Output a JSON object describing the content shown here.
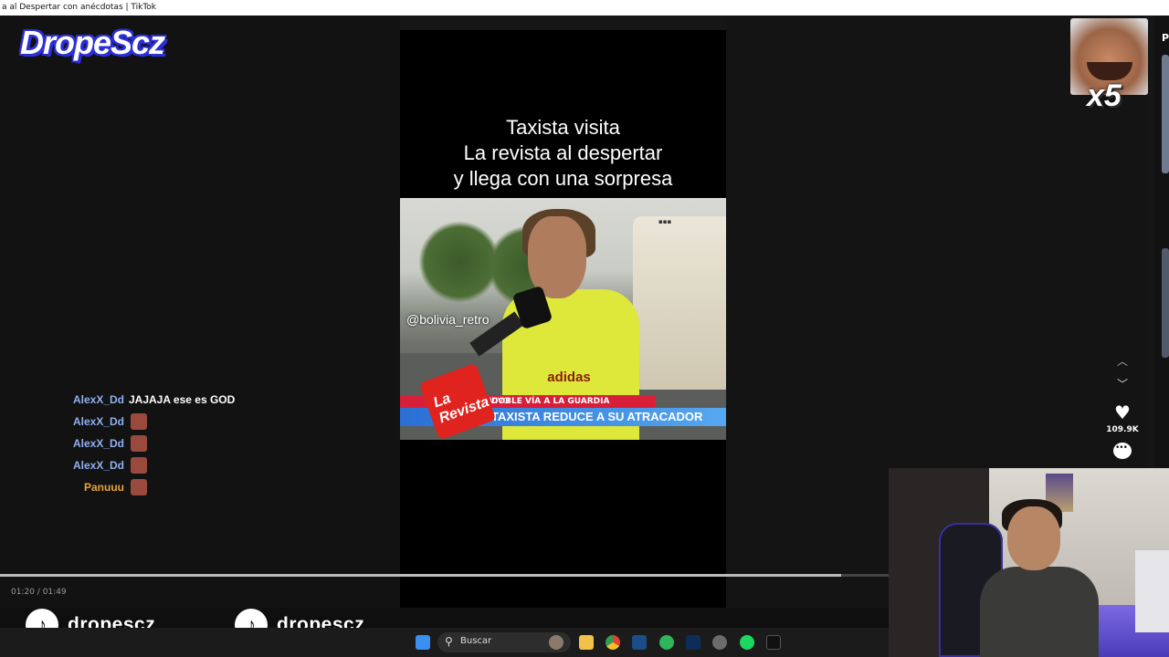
{
  "window": {
    "title": "a al Despertar con anécdotas | TikTok"
  },
  "stream_overlay": {
    "brand": "DropeScz",
    "emote_multiplier": "x5",
    "tiktok_handle_1": "dropescz",
    "tiktok_handle_2": "dropescz"
  },
  "video": {
    "caption_lines": [
      "Taxista visita",
      "La revista al despertar",
      "y llega con una sorpresa"
    ],
    "watermark": "@bolivia_retro",
    "brand_logo_text": "La Revista",
    "chyron_live": "VIVO",
    "chyron_top": "DOBLE VÍA A LA GUARDIA",
    "chyron_bottom": "TAXISTA REDUCE A SU ATRACADOR",
    "shirt_brand": "adidas",
    "progress": 0.947,
    "time": "01:20 / 01:49"
  },
  "actions": {
    "likes": "109.9K"
  },
  "side_strip": {
    "header_initial": "P"
  },
  "chat": [
    {
      "user": "AlexX_Dd",
      "msg": "JAJAJA ese es GOD",
      "emote": false,
      "color": "#8fb0ef"
    },
    {
      "user": "AlexX_Dd",
      "msg": "",
      "emote": true,
      "color": "#8fb0ef"
    },
    {
      "user": "AlexX_Dd",
      "msg": "",
      "emote": true,
      "color": "#8fb0ef"
    },
    {
      "user": "AlexX_Dd",
      "msg": "",
      "emote": true,
      "color": "#8fb0ef"
    },
    {
      "user": "Panuuu",
      "msg": "",
      "emote": true,
      "color": "#e8a23a"
    }
  ],
  "taskbar": {
    "search_placeholder": "Buscar"
  },
  "icons": [
    "windows-icon",
    "search-icon",
    "folder-icon",
    "chrome-icon",
    "steam-icon",
    "xbox-icon",
    "photoshop-icon",
    "settings-icon",
    "spotify-icon",
    "tiktok-icon",
    "heart-icon",
    "comment-icon",
    "chevron-up-icon",
    "chevron-down-icon"
  ]
}
